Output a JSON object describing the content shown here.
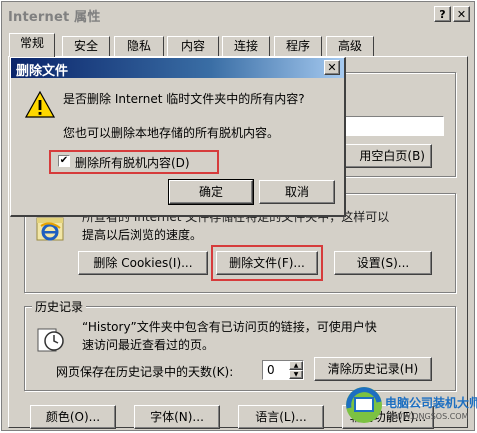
{
  "window": {
    "title": "Internet 属性",
    "help_button": "?",
    "close_button": "✕"
  },
  "tabs": [
    {
      "label": "常规"
    },
    {
      "label": "安全"
    },
    {
      "label": "隐私"
    },
    {
      "label": "内容"
    },
    {
      "label": "连接"
    },
    {
      "label": "程序"
    },
    {
      "label": "高级"
    }
  ],
  "home": {
    "blank_page_button": "用空白页(B)"
  },
  "temp_files": {
    "desc_line1": "所查看的 Internet 文件存储在特定的文件夹中，这样可以",
    "desc_line2": "提高以后浏览的速度。",
    "delete_cookies_button": "删除 Cookies(I)...",
    "delete_files_button": "删除文件(F)...",
    "settings_button": "设置(S)..."
  },
  "history": {
    "legend": "历史记录",
    "desc_line1": "“History”文件夹中包含有已访问页的链接，可使用户快",
    "desc_line2": "速访问最近查看过的页。",
    "days_label": "网页保存在历史记录中的天数(K):",
    "days_value": "0",
    "clear_button": "清除历史记录(H)"
  },
  "bottom_buttons": {
    "colors": "颜色(O)...",
    "fonts": "字体(N)...",
    "languages": "语言(L)...",
    "accessibility": "辅助功能(E)..."
  },
  "dialog": {
    "title": "删除文件",
    "close_button": "✕",
    "message_line1": "是否删除 Internet 临时文件夹中的所有内容?",
    "message_line2": "您也可以删除本地存储的所有脱机内容。",
    "checkbox_label": "删除所有脱机内容(D)",
    "checkbox_checked": true,
    "ok_button": "确定",
    "cancel_button": "取消"
  },
  "watermark": {
    "brand_cn": "电脑公司装机大师",
    "brand_url": "WWW.DNGSOS.COM"
  },
  "colors": {
    "dialog_face": "#d4d0c8",
    "title_gradient_start": "#0a246a",
    "highlight_border": "#d63b3b",
    "watermark_blue": "#1d6fc1",
    "watermark_green": "#7cc242"
  }
}
